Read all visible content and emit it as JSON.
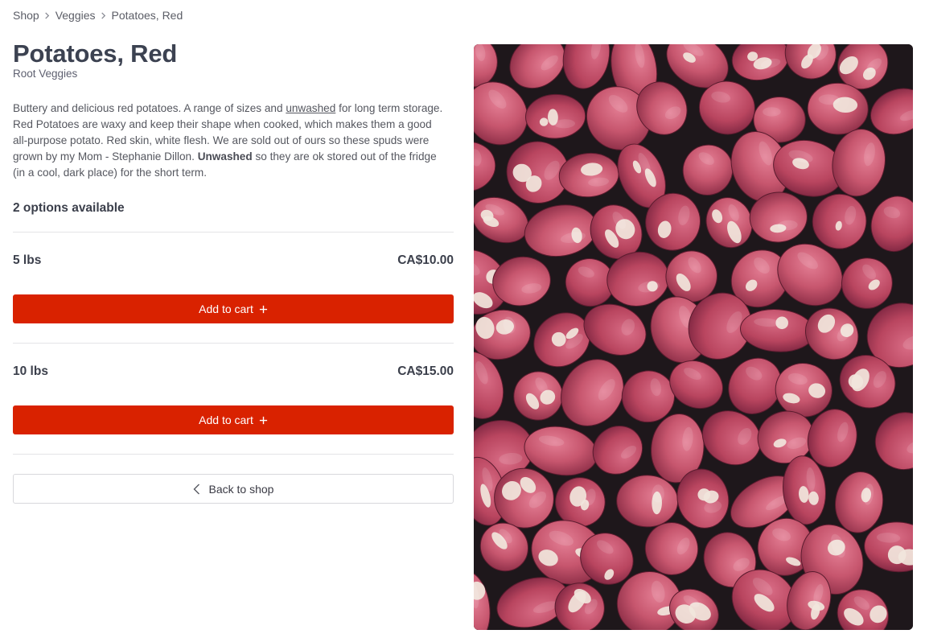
{
  "breadcrumb": {
    "items": [
      "Shop",
      "Veggies",
      "Potatoes, Red"
    ]
  },
  "product": {
    "title": "Potatoes, Red",
    "category": "Root Veggies",
    "description": {
      "part1": "Buttery and delicious red potatoes. A range of sizes and ",
      "underlined": "unwashed",
      "part2": " for long term storage. Red Potatoes are waxy and keep their shape when cooked, which makes them a good all-purpose potato. Red skin, white flesh. We are sold out of ours so these spuds were grown by my Mom - Stephanie Dillon. ",
      "bold": "Unwashed",
      "part3": " so they are ok stored out of the fridge (in a cool, dark place) for the short term."
    },
    "image_alt": "Crate of red potatoes"
  },
  "options": {
    "count_label": "2 options available",
    "items": [
      {
        "size": "5 lbs",
        "price": "CA$10.00",
        "button_label": "Add to cart"
      },
      {
        "size": "10 lbs",
        "price": "CA$15.00",
        "button_label": "Add to cart"
      }
    ]
  },
  "back_button": {
    "label": "Back to shop"
  },
  "colors": {
    "accent": "#d92200",
    "title": "#3c4251",
    "potato_skin": "#c7566e",
    "potato_flesh": "#f1e6dc"
  },
  "icons": {
    "breadcrumb_separator": "chevron-right-icon",
    "add": "plus-icon",
    "back": "chevron-left-icon"
  }
}
